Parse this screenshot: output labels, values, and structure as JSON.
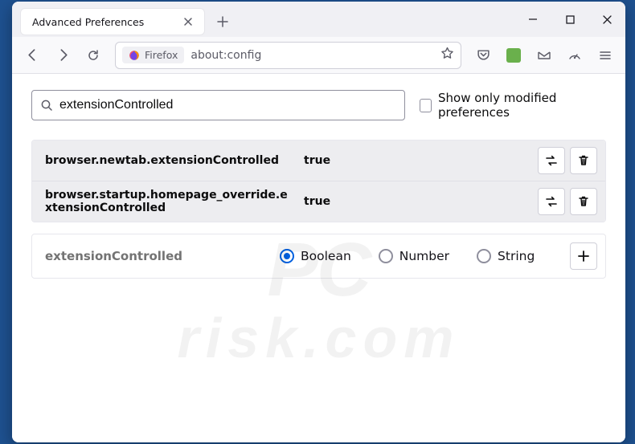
{
  "window": {
    "tab_title": "Advanced Preferences"
  },
  "toolbar": {
    "identity_label": "Firefox",
    "url": "about:config"
  },
  "search": {
    "value": "extensionControlled",
    "modified_only_label": "Show only modified preferences"
  },
  "prefs": [
    {
      "name": "browser.newtab.extensionControlled",
      "value": "true"
    },
    {
      "name": "browser.startup.homepage_override.extensionControlled",
      "value": "true"
    }
  ],
  "new_pref": {
    "name": "extensionControlled",
    "types": {
      "boolean": "Boolean",
      "number": "Number",
      "string": "String"
    }
  },
  "watermark": {
    "top": "PC",
    "host": "risk.com"
  }
}
